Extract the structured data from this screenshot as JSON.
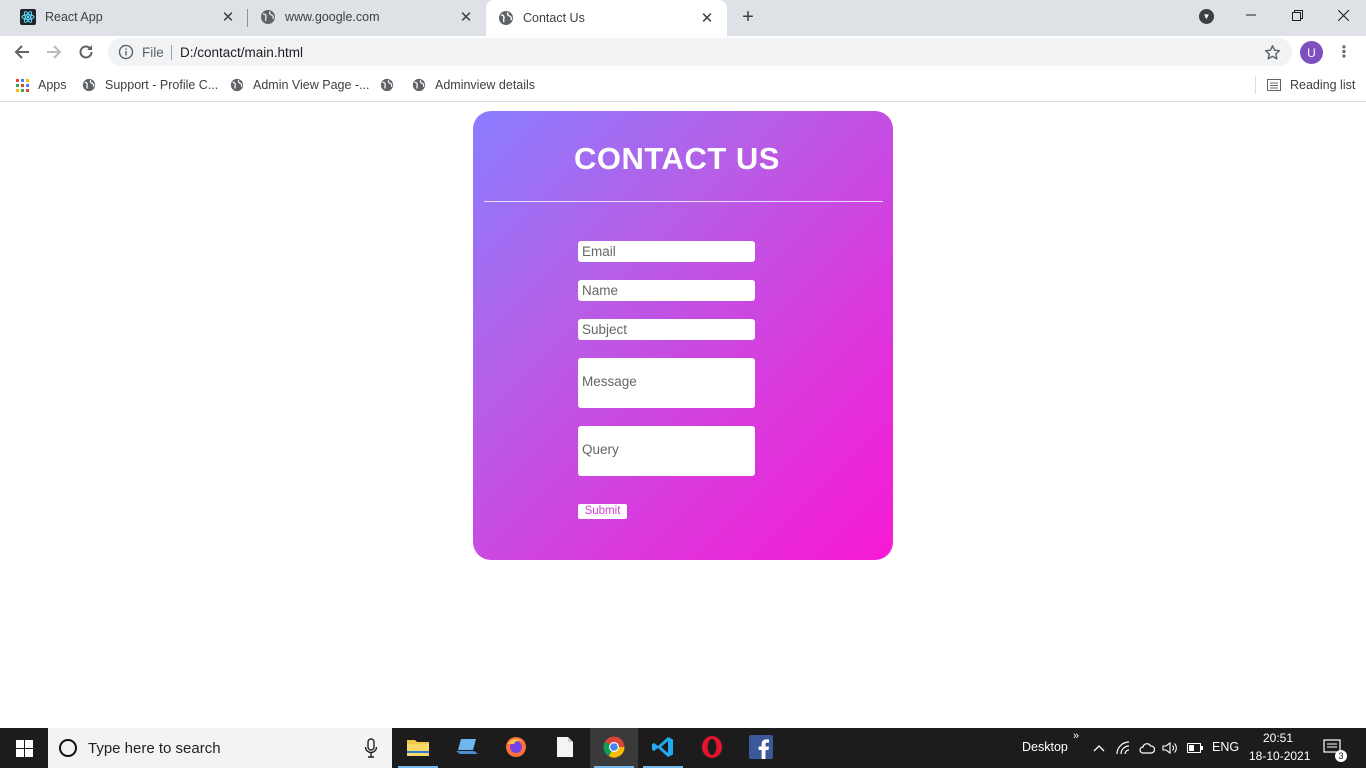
{
  "browser": {
    "tabs": [
      {
        "title": "React App",
        "icon": "react-icon"
      },
      {
        "title": "www.google.com",
        "icon": "globe-icon"
      },
      {
        "title": "Contact Us",
        "icon": "globe-icon",
        "active": true
      }
    ],
    "address": {
      "scheme": "File",
      "url": "D:/contact/main.html"
    },
    "profile_initial": "U",
    "bookmarks": [
      {
        "label": "Apps",
        "icon": "apps-grid-icon"
      },
      {
        "label": "Support - Profile C...",
        "icon": "globe-icon"
      },
      {
        "label": "Admin View Page -...",
        "icon": "globe-icon"
      },
      {
        "label": "",
        "icon": "globe-icon"
      },
      {
        "label": "Adminview details",
        "icon": "globe-icon"
      }
    ],
    "reading_list": "Reading list"
  },
  "page": {
    "title": "CONTACT US",
    "fields": {
      "email": "Email",
      "name": "Name",
      "subject": "Subject",
      "message": "Message",
      "query": "Query"
    },
    "submit_label": "Submit",
    "gradient_colors": [
      "#8a7dff",
      "#f81ad6"
    ]
  },
  "taskbar": {
    "search_placeholder": "Type here to search",
    "desktop_label": "Desktop",
    "language": "ENG",
    "time": "20:51",
    "date": "18-10-2021",
    "notification_count": "3",
    "apps": [
      "file-explorer-icon",
      "laptop-icon",
      "firefox-icon",
      "notepad-icon",
      "chrome-icon",
      "vscode-icon",
      "opera-icon",
      "facebook-icon"
    ]
  }
}
